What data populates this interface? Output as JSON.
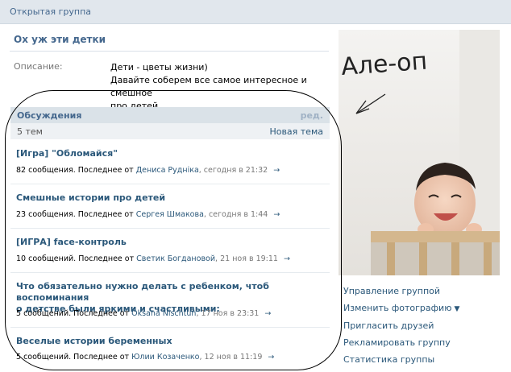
{
  "header": {
    "label": "Открытая группа"
  },
  "group": {
    "name": "Ох уж эти детки",
    "description_label": "Описание:",
    "description_line1": "Дети - цветы жизни)",
    "description_line2": "Давайте соберем все самое интересное и смешное",
    "description_line3": "про детей."
  },
  "discussions": {
    "title": "Обсуждения",
    "edit_label": "ред.",
    "count_label": "5 тем",
    "new_topic_label": "Новая тема",
    "topics": [
      {
        "title": "[Игра] \"Обломайся\"",
        "meta_prefix": "82 сообщения. Последнее от",
        "author": "Дениса Рудніка",
        "when": ", сегодня в 21:32"
      },
      {
        "title": "Смешные истории про детей",
        "meta_prefix": "23 сообщения. Последнее от",
        "author": "Сергея Шмакова",
        "when": ", сегодня в 1:44"
      },
      {
        "title": "[ИГРА] face-контроль",
        "meta_prefix": "10 сообщений. Последнее от",
        "author": "Светик Богдановой",
        "when": ", 21 ноя в 19:11"
      },
      {
        "title_line1": "Что обязательно нужно делать с ребенком, чтоб воспоминания",
        "title_line2": "о детстве были яркими и счастливыми:",
        "meta_prefix": "5 сообщений. Последнее от",
        "author": "Oksana Nischtun",
        "when": ", 17 ноя в 23:31"
      },
      {
        "title": "Веселые истории беременных",
        "meta_prefix": "5 сообщений. Последнее от",
        "author": "Юлии Козаченко",
        "when": ", 12 ноя в 11:19"
      }
    ],
    "arrow_glyph": "→"
  },
  "photo": {
    "handwriting": "Але-оп"
  },
  "actions": {
    "manage": "Управление группой",
    "change_photo": "Изменить фотографию",
    "invite": "Пригласить друзей",
    "advertise": "Рекламировать группу",
    "stats": "Статистика группы",
    "caret": "▼"
  }
}
